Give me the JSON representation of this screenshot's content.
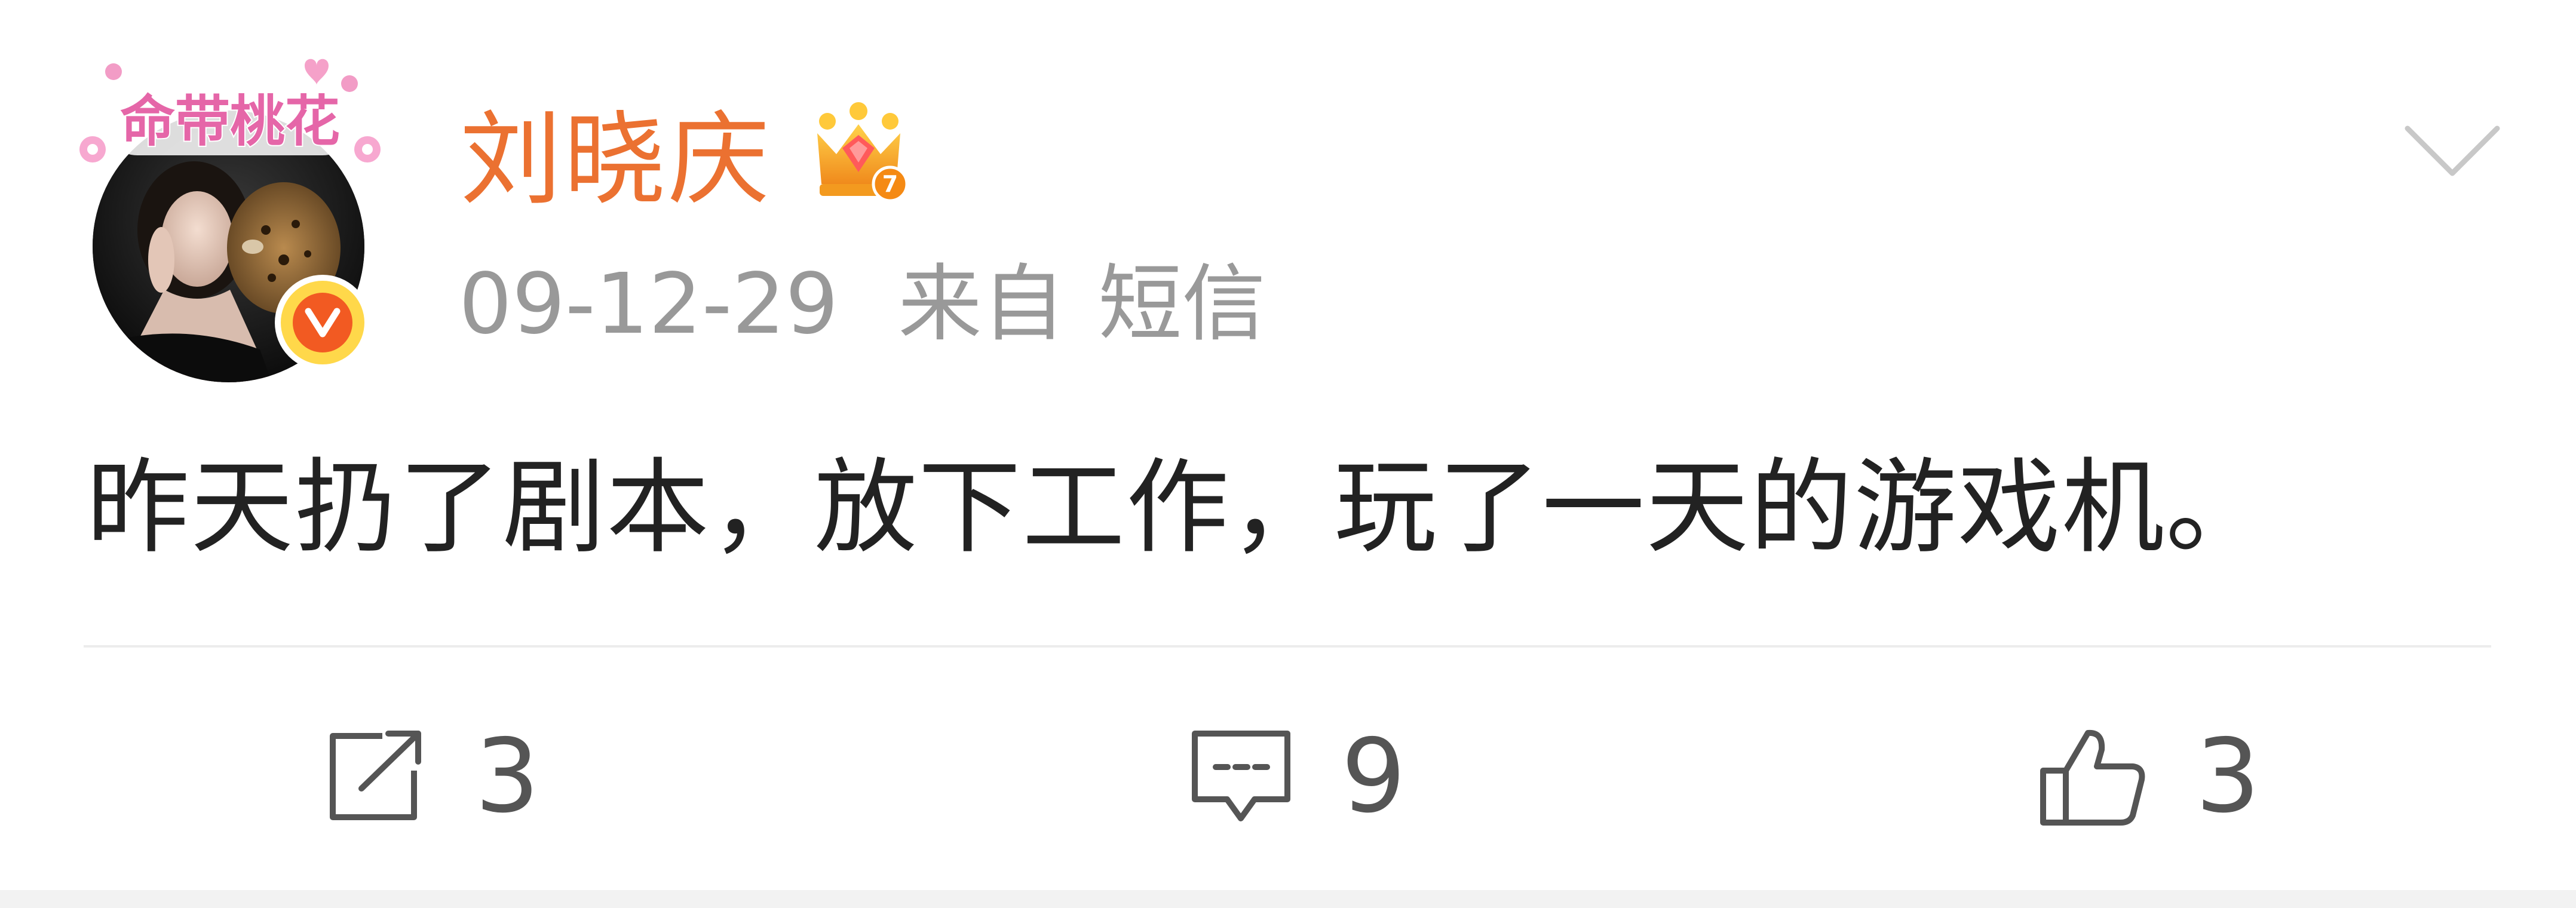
{
  "post": {
    "author": {
      "name": "刘晓庆",
      "avatar_frame_text": "命带桃花",
      "verified_badge_icon": "verified-v-icon",
      "vip_badge_icon": "crown-level-7-icon",
      "vip_level": "7"
    },
    "meta": {
      "date": "09-12-29",
      "source_prefix": "来自",
      "source": "短信"
    },
    "content": "昨天扔了剧本，放下工作，玩了一天的游戏机。",
    "menu_icon": "chevron-down-icon",
    "actions": {
      "repost": {
        "icon": "share-icon",
        "count": "3"
      },
      "comment": {
        "icon": "comment-icon",
        "count": "9"
      },
      "like": {
        "icon": "thumbs-up-icon",
        "count": "3"
      }
    }
  },
  "colors": {
    "name": "#eb7131",
    "meta": "#999999",
    "text": "#222222",
    "icon": "#555555",
    "verified": "#f25a22",
    "verified_ring": "#ffd84a",
    "crown": "#f5a623"
  }
}
